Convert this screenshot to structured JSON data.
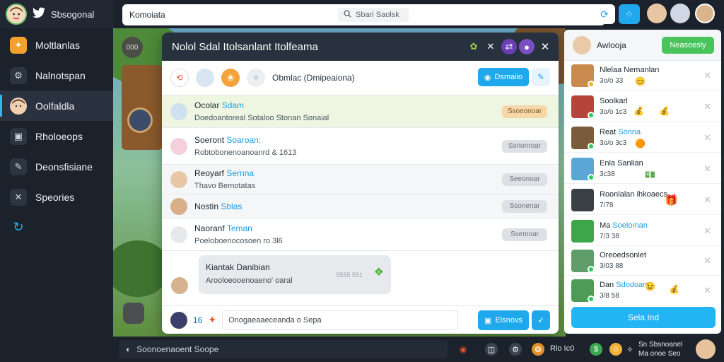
{
  "app": {
    "title": "Sbsogonal"
  },
  "sidebar": {
    "items": [
      {
        "label": "Moltlanlas",
        "icon": "folder-icon"
      },
      {
        "label": "Nalnotspan",
        "icon": "gear-icon"
      },
      {
        "label": "Oolfaldla",
        "icon": "avatar-icon"
      },
      {
        "label": "Rholoeops",
        "icon": "monitor-icon"
      },
      {
        "label": "Deonsfisiane",
        "icon": "pencil-icon"
      },
      {
        "label": "Speories",
        "icon": "close-box-icon"
      },
      {
        "label": "",
        "icon": "refresh-icon"
      }
    ]
  },
  "topbar": {
    "tab_label": "Komoiata",
    "search_placeholder": "Sbari Saolsk"
  },
  "scene": {
    "mini_label": "000"
  },
  "modal": {
    "title": "Nolol Sdal Itolsanlant Itolfeama",
    "tabs_label": "Obmlac (Dmipeaiona)",
    "dm_button": "Dsmaiio",
    "threads": [
      {
        "name": "Ocolar",
        "highlight": "Sdam",
        "sub": "Doedoantoreal Sotaloo Stonan Sonaial",
        "tag": "Ssoeonoar",
        "featured": true
      },
      {
        "name": "Soeront",
        "highlight": "Soaroan:",
        "sub": "Robtobonenoanoanrd & 1613",
        "tag": "Ssnonroar",
        "featured": false
      },
      {
        "name": "Reoyarf",
        "highlight": "Sernna",
        "sub": "Thavo Bemotatas",
        "tag": "Seeonoar",
        "featured": false
      },
      {
        "name": "Nostin",
        "highlight": "Sblas",
        "sub": "",
        "tag": "Ssonenar",
        "featured": false
      },
      {
        "name": "Naoranf",
        "highlight": "Teman",
        "sub": "Poeloboenocosoen ro 3l6",
        "tag": "Ssemoar",
        "featured": false
      }
    ],
    "bubble": {
      "line1": "Kiantak Danibian",
      "line2": "Arooloeooenoaeno' oaral",
      "time": "5555 551"
    },
    "composer": {
      "count": "16",
      "placeholder": "Onogaeaaeceanda o Sepa",
      "send_label": "Elsnovs"
    }
  },
  "rpanel": {
    "title": "Awlooja",
    "button": "Neasoesly",
    "friends": [
      {
        "name": "Nlelaa Nemanlan",
        "status": "3o/o 33"
      },
      {
        "name": "Soolkarl",
        "status": "3o/o 1c3"
      },
      {
        "name": "Reat",
        "highlight": "Sonna",
        "status": "3o/o 3c3"
      },
      {
        "name": "Enla Sanlian",
        "status": "3c38"
      },
      {
        "name": "Roonlalan ihkoaecs",
        "status": "7/78"
      },
      {
        "name": "Ma",
        "highlight": "Soeloman",
        "status": "7/3 38"
      },
      {
        "name": "Oreoedsonlet",
        "status": "3/03 88"
      },
      {
        "name": "Dan",
        "highlight": "Sdodoan",
        "status": "3/8 58"
      }
    ],
    "cta": "Sela Ind"
  },
  "bottombar": {
    "input_placeholder": "Soonoenaoent Soope",
    "label_mid": "Rlo Ic0",
    "stack_line1": "Sn Sbsnoanel",
    "stack_line2": "Ma onoe Seo"
  },
  "colors": {
    "accent": "#1fa8ec",
    "success": "#49c35c",
    "sidebar": "#1c222c"
  }
}
